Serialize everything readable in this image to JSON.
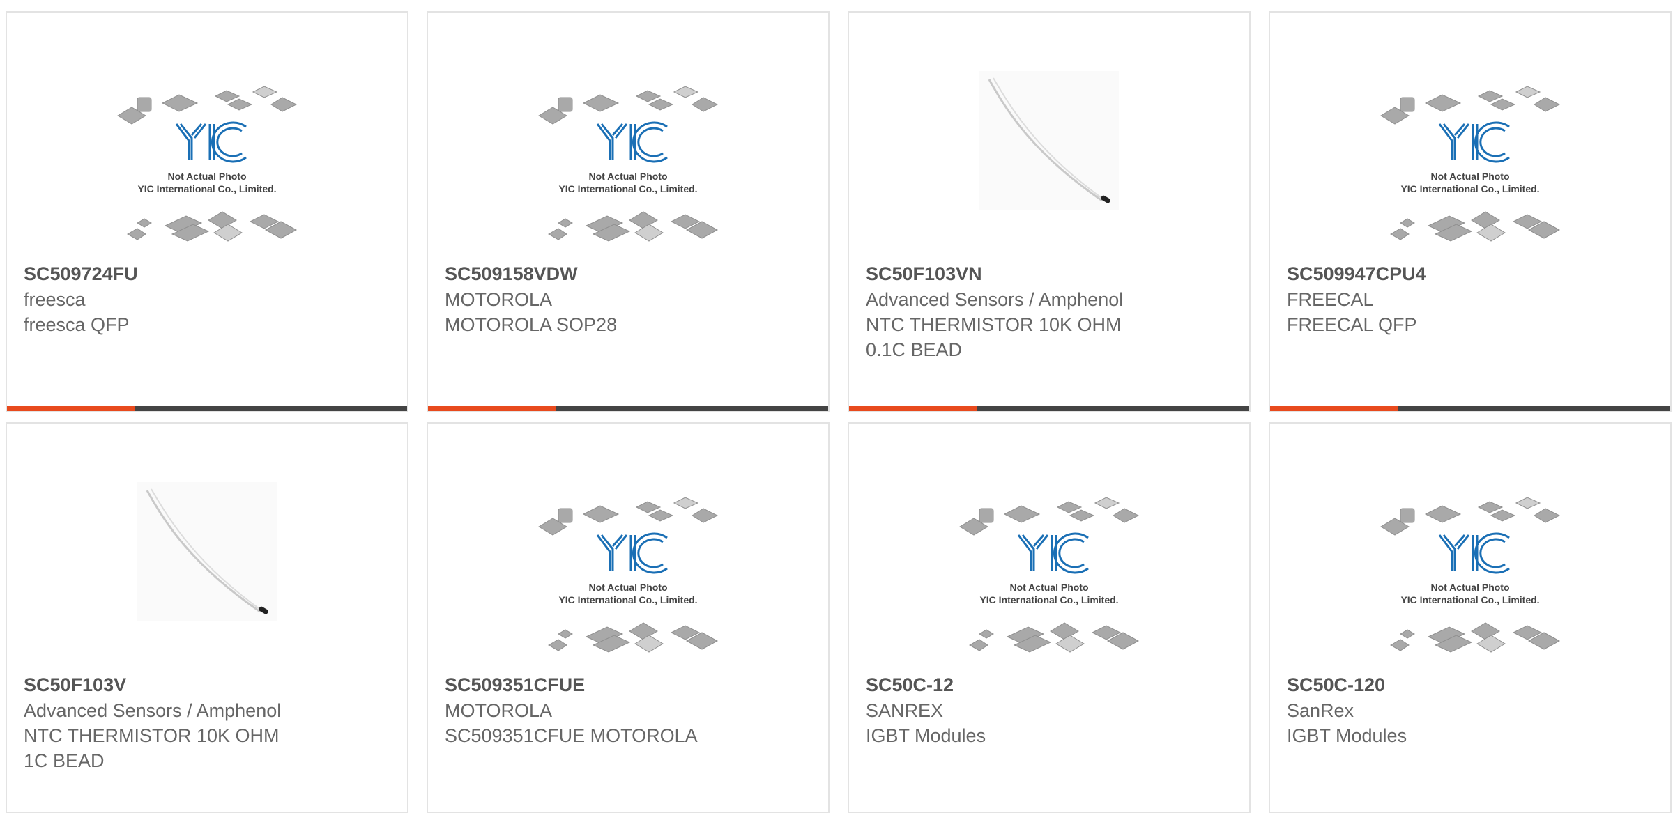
{
  "colors": {
    "accent": "#e84a1d",
    "bar_dark": "#444444",
    "logo_blue": "#1a6fb5",
    "border": "#e3e3e3"
  },
  "placeholder_image": {
    "caption_line1": "Not Actual Photo",
    "caption_line2": "YIC International Co., Limited."
  },
  "products": [
    {
      "part": "SC509724FU",
      "lines": [
        "freesca",
        "freesca QFP"
      ],
      "image": "placeholder"
    },
    {
      "part": "SC509158VDW",
      "lines": [
        "MOTOROLA",
        "MOTOROLA SOP28"
      ],
      "image": "placeholder"
    },
    {
      "part": "SC50F103VN",
      "lines": [
        "Advanced Sensors / Amphenol",
        "NTC THERMISTOR 10K OHM",
        "0.1C BEAD"
      ],
      "image": "thermistor"
    },
    {
      "part": "SC509947CPU4",
      "lines": [
        "FREECAL",
        "FREECAL QFP"
      ],
      "image": "placeholder"
    },
    {
      "part": "SC50F103V",
      "lines": [
        "Advanced Sensors / Amphenol",
        "NTC THERMISTOR 10K OHM",
        "1C BEAD"
      ],
      "image": "thermistor"
    },
    {
      "part": "SC509351CFUE",
      "lines": [
        "MOTOROLA",
        "SC509351CFUE MOTOROLA"
      ],
      "image": "placeholder"
    },
    {
      "part": "SC50C-12",
      "lines": [
        "SANREX",
        "IGBT Modules"
      ],
      "image": "placeholder"
    },
    {
      "part": "SC50C-120",
      "lines": [
        "SanRex",
        "IGBT Modules"
      ],
      "image": "placeholder"
    }
  ]
}
